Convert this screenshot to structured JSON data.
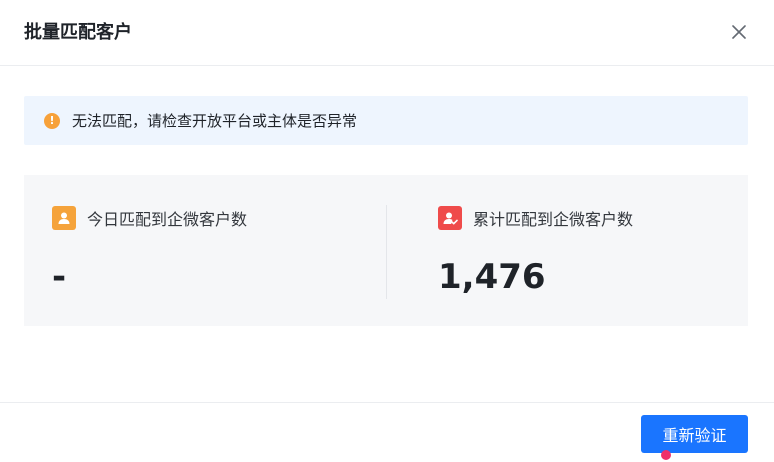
{
  "dialog": {
    "title": "批量匹配客户",
    "close_icon": "close-icon"
  },
  "alert": {
    "icon": "warning-icon",
    "icon_glyph": "!",
    "text": "无法匹配，请检查开放平台或主体是否异常"
  },
  "stats": [
    {
      "icon": "user-icon",
      "color": "#f5a33b",
      "label": "今日匹配到企微客户数",
      "value": "-"
    },
    {
      "icon": "user-check-icon",
      "color": "#ef4b4b",
      "label": "累计匹配到企微客户数",
      "value": "1,476"
    }
  ],
  "footer": {
    "primary_button": "重新验证"
  },
  "colors": {
    "primary": "#1a75ff",
    "alert_bg": "#eef5fe",
    "warning": "#f7a13a"
  }
}
